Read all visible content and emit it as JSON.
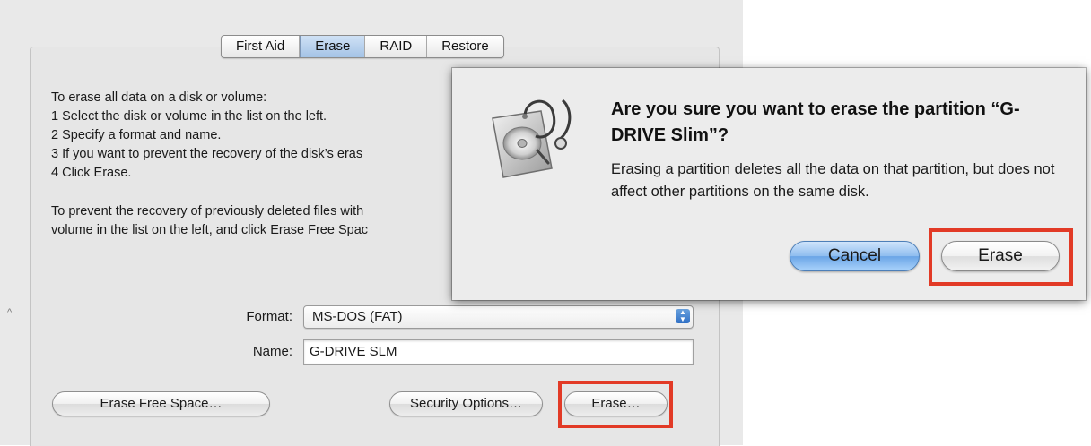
{
  "tabs": [
    {
      "label": "First Aid",
      "active": false
    },
    {
      "label": "Erase",
      "active": true
    },
    {
      "label": "RAID",
      "active": false
    },
    {
      "label": "Restore",
      "active": false
    }
  ],
  "instructions": {
    "lines": [
      "To erase all data on a disk or volume:",
      "1 Select the disk or volume in the list on the left.",
      "2 Specify a format and name.",
      "3 If you want to prevent the recovery of the disk’s eras",
      "4 Click Erase."
    ],
    "free_space_lines": [
      "To prevent the recovery of previously deleted files with",
      "volume in the list on the left, and click Erase Free Spac"
    ]
  },
  "form": {
    "format_label": "Format:",
    "format_value": "MS-DOS (FAT)",
    "name_label": "Name:",
    "name_value": "G-DRIVE SLM"
  },
  "buttons": {
    "erase_free_space": "Erase Free Space…",
    "security_options": "Security Options…",
    "erase": "Erase…"
  },
  "alert": {
    "icon": "disk-utility-icon",
    "title": "Are you sure you want to erase the partition “G-DRIVE Slim”?",
    "message": "Erasing a partition deletes all the data on that partition, but does not affect other partitions on the same disk.",
    "cancel_label": "Cancel",
    "erase_label": "Erase"
  },
  "colors": {
    "highlight_red": "#e23a26",
    "default_button_blue": "#6aa5e6",
    "tab_active_blue": "#a4c3e6"
  }
}
